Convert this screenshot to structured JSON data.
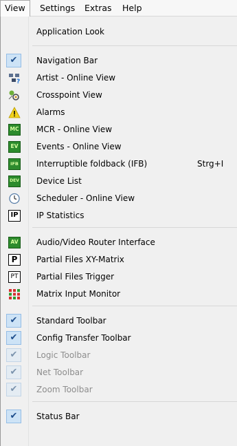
{
  "menubar": {
    "items": [
      {
        "label": "View"
      },
      {
        "label": "Settings"
      },
      {
        "label": "Extras"
      },
      {
        "label": "Help"
      }
    ]
  },
  "menu": {
    "items": [
      {
        "label": "Application Look"
      },
      {
        "label": "Navigation Bar",
        "icon": "checkmark-icon"
      },
      {
        "label": "Artist - Online View",
        "icon": "artist-view-icon"
      },
      {
        "label": "Crosspoint View",
        "icon": "crosspoint-icon"
      },
      {
        "label": "Alarms",
        "icon": "alarm-warning-icon"
      },
      {
        "label": "MCR - Online View",
        "icon": "mcr-icon",
        "badge": "MC"
      },
      {
        "label": "Events - Online View",
        "icon": "events-icon",
        "badge": "EV"
      },
      {
        "label": "Interruptible foldback (IFB)",
        "icon": "ifb-icon",
        "badge": "IFB",
        "shortcut": "Strg+I"
      },
      {
        "label": "Device List",
        "icon": "device-list-icon",
        "badge": "DEV"
      },
      {
        "label": "Scheduler - Online View",
        "icon": "clock-icon"
      },
      {
        "label": "IP Statistics",
        "icon": "ip-statistics-icon",
        "badge": "IP"
      },
      {
        "label": "Audio/Video Router Interface",
        "icon": "av-router-icon",
        "badge": "AV"
      },
      {
        "label": "Partial Files XY-Matrix",
        "icon": "partial-files-icon",
        "badge": "P"
      },
      {
        "label": "Partial Files Trigger",
        "icon": "partial-trigger-icon",
        "badge": "PT"
      },
      {
        "label": "Matrix Input Monitor",
        "icon": "matrix-monitor-icon"
      },
      {
        "label": "Standard Toolbar",
        "icon": "checkmark-icon"
      },
      {
        "label": "Config Transfer Toolbar",
        "icon": "checkmark-icon"
      },
      {
        "label": "Logic Toolbar",
        "icon": "checkmark-icon",
        "disabled": true
      },
      {
        "label": "Net Toolbar",
        "icon": "checkmark-icon",
        "disabled": true
      },
      {
        "label": "Zoom Toolbar",
        "icon": "checkmark-icon",
        "disabled": true
      },
      {
        "label": "Status Bar",
        "icon": "checkmark-icon"
      }
    ]
  },
  "colors": {
    "menu_background": "#f0f0f0",
    "check_background": "#cde3f6",
    "disabled_text": "#8d8d8d"
  }
}
